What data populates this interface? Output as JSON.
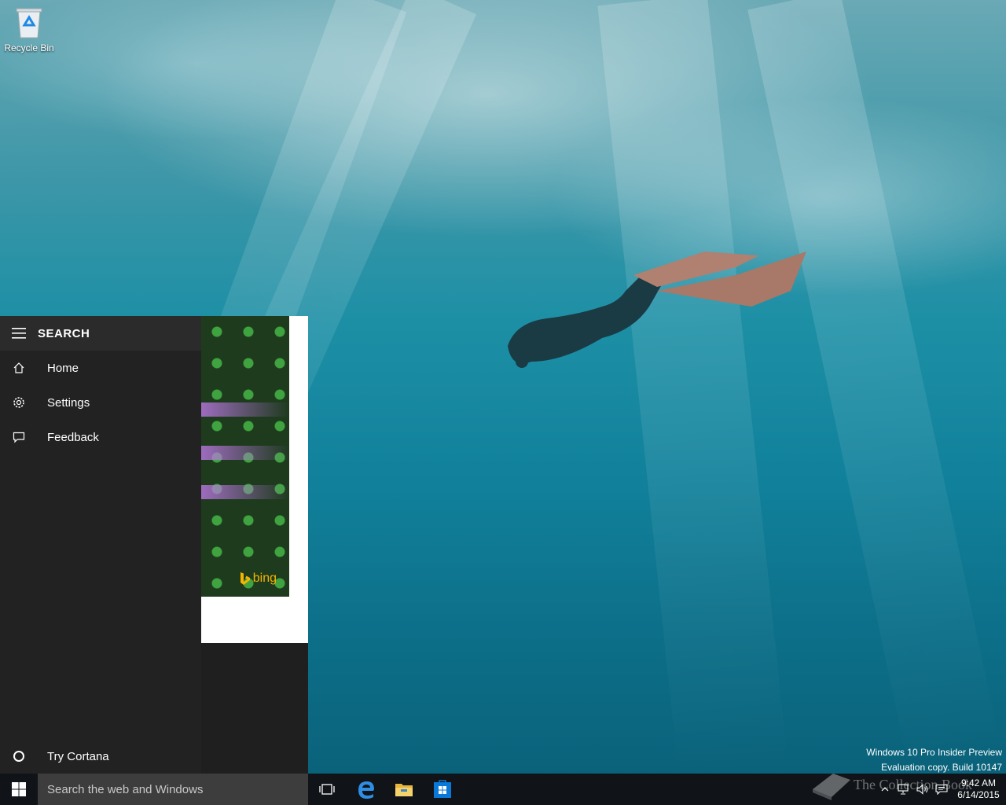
{
  "desktop": {
    "icons": [
      {
        "label": "Recycle Bin",
        "icon": "recycle-bin-icon"
      }
    ],
    "watermark": {
      "line1": "Windows 10 Pro Insider Preview",
      "line2": "Evaluation copy. Build 10147"
    }
  },
  "search_panel": {
    "header": {
      "title": "SEARCH",
      "icon": "hamburger-menu-icon"
    },
    "nav_items": [
      {
        "label": "Home",
        "icon": "home-icon"
      },
      {
        "label": "Settings",
        "icon": "gear-icon"
      },
      {
        "label": "Feedback",
        "icon": "feedback-icon"
      }
    ],
    "cortana": {
      "label": "Try Cortana",
      "icon": "cortana-circle-icon"
    },
    "bing_brand": "bing"
  },
  "taskbar": {
    "start_icon": "windows-logo-icon",
    "search_placeholder": "Search the web and Windows",
    "pinned": [
      {
        "icon": "task-view-icon"
      },
      {
        "icon": "edge-browser-icon"
      },
      {
        "icon": "file-explorer-icon"
      },
      {
        "icon": "store-icon"
      }
    ],
    "tray": {
      "time": "9:42 AM",
      "date": "6/14/2015",
      "icons": [
        "chevron-up-icon",
        "network-icon",
        "volume-icon",
        "action-center-icon"
      ]
    },
    "overlay_watermark": "The Collection Book"
  },
  "colors": {
    "taskbar_bg": "#101418",
    "search_box_bg": "#3d3d3d",
    "panel_bg": "#222222",
    "accent_store": "#0a78d7",
    "bing_yellow": "#f4b400"
  }
}
